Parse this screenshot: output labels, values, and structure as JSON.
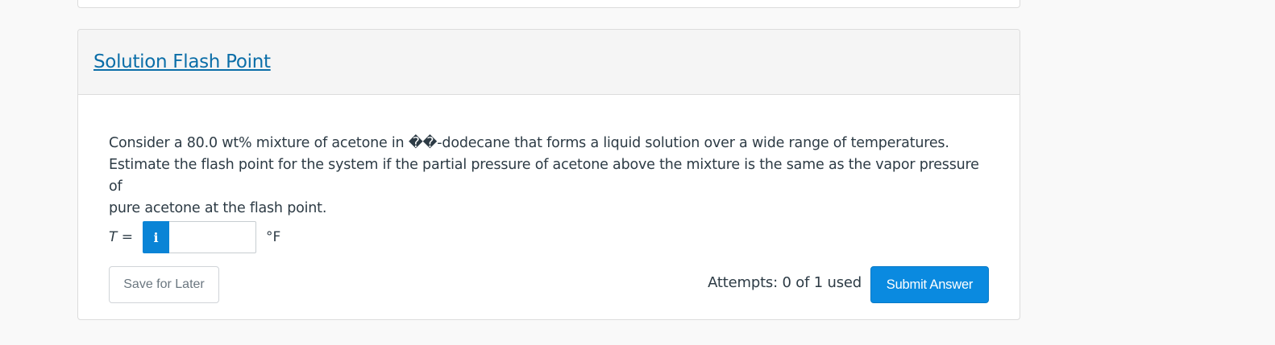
{
  "title": "Solution Flash Point",
  "question": {
    "line1": "Consider a 80.0 wt% mixture of acetone in ��-dodecane that forms a liquid solution over a wide range of temperatures.",
    "line2": "Estimate the flash point for the system if the partial pressure of acetone above the mixture is the same as the vapor pressure of",
    "line3": "pure acetone at the flash point."
  },
  "answer": {
    "variable": "T",
    "equals": " =",
    "info_icon": "i",
    "value": "",
    "placeholder": "",
    "unit": "°F"
  },
  "actions": {
    "save_label": "Save for Later",
    "attempts_label": "Attempts: 0 of 1 used",
    "submit_label": "Submit Answer"
  },
  "colors": {
    "link": "#0b6ea8",
    "primary": "#0a8ae0",
    "text": "#2d3b45"
  }
}
